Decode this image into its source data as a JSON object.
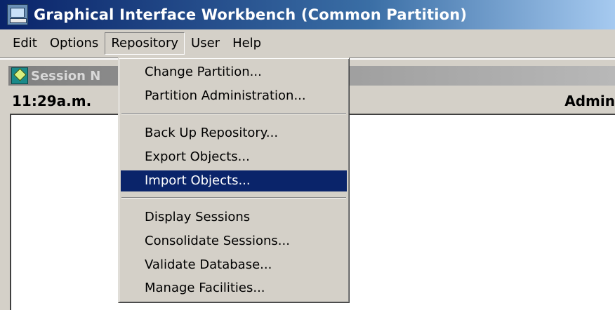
{
  "window": {
    "title": "Graphical Interface Workbench (Common Partition)"
  },
  "menubar": {
    "items": [
      "Edit",
      "Options",
      "Repository",
      "User",
      "Help"
    ]
  },
  "session": {
    "title": "Session N",
    "time": "11:29a.m.",
    "user": "Admin"
  },
  "repository_menu": {
    "items": [
      "Change Partition...",
      "Partition Administration...",
      "Back Up Repository...",
      "Export Objects...",
      "Import Objects...",
      "Display Sessions",
      "Consolidate Sessions...",
      "Validate Database...",
      "Manage Facilities..."
    ],
    "highlighted": "Import Objects..."
  },
  "colors": {
    "highlight": "#0a246a",
    "titlebar": "#0a246a",
    "face": "#d4d0c8"
  }
}
